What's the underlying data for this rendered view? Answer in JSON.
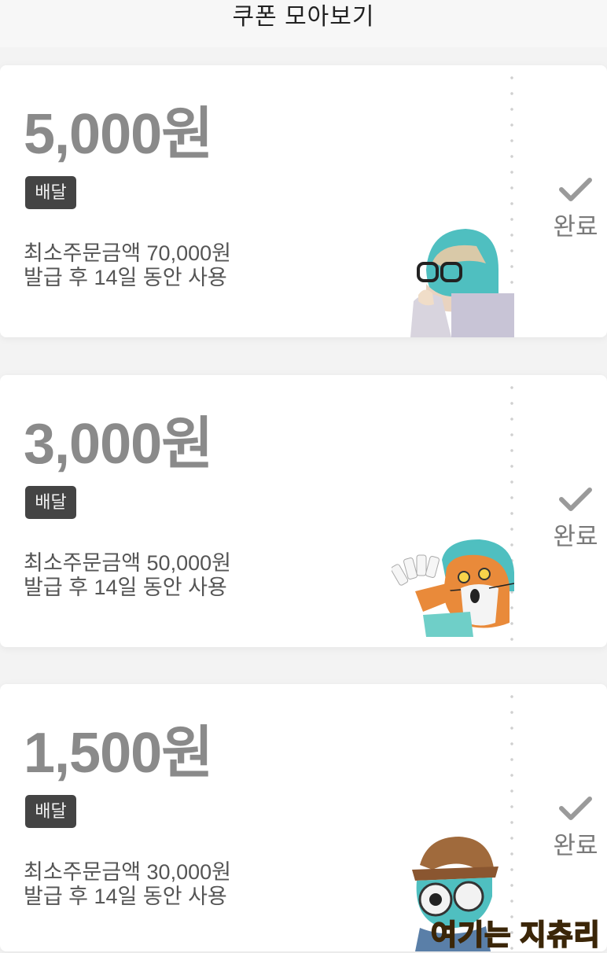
{
  "header": {
    "title": "쿠폰 모아보기"
  },
  "coupons": [
    {
      "amount": "5,000원",
      "badge": "배달",
      "min_order": "최소주문금액 70,000원",
      "period": "발급 후 14일 동안 사용",
      "status": "완료",
      "sticker": "character-with-glasses"
    },
    {
      "amount": "3,000원",
      "badge": "배달",
      "min_order": "최소주문금액 50,000원",
      "period": "발급 후 14일 동안 사용",
      "status": "완료",
      "sticker": "cat-holding-coupons"
    },
    {
      "amount": "1,500원",
      "badge": "배달",
      "min_order": "최소주문금액 30,000원",
      "period": "발급 후 14일 동안 사용",
      "status": "완료",
      "sticker": "detective-character"
    }
  ],
  "caption": "여기는 지츄리",
  "colors": {
    "amount": "#8a8a8a",
    "badge_bg": "#444444",
    "status": "#7a7a7a",
    "caption": "#f3b51c"
  }
}
